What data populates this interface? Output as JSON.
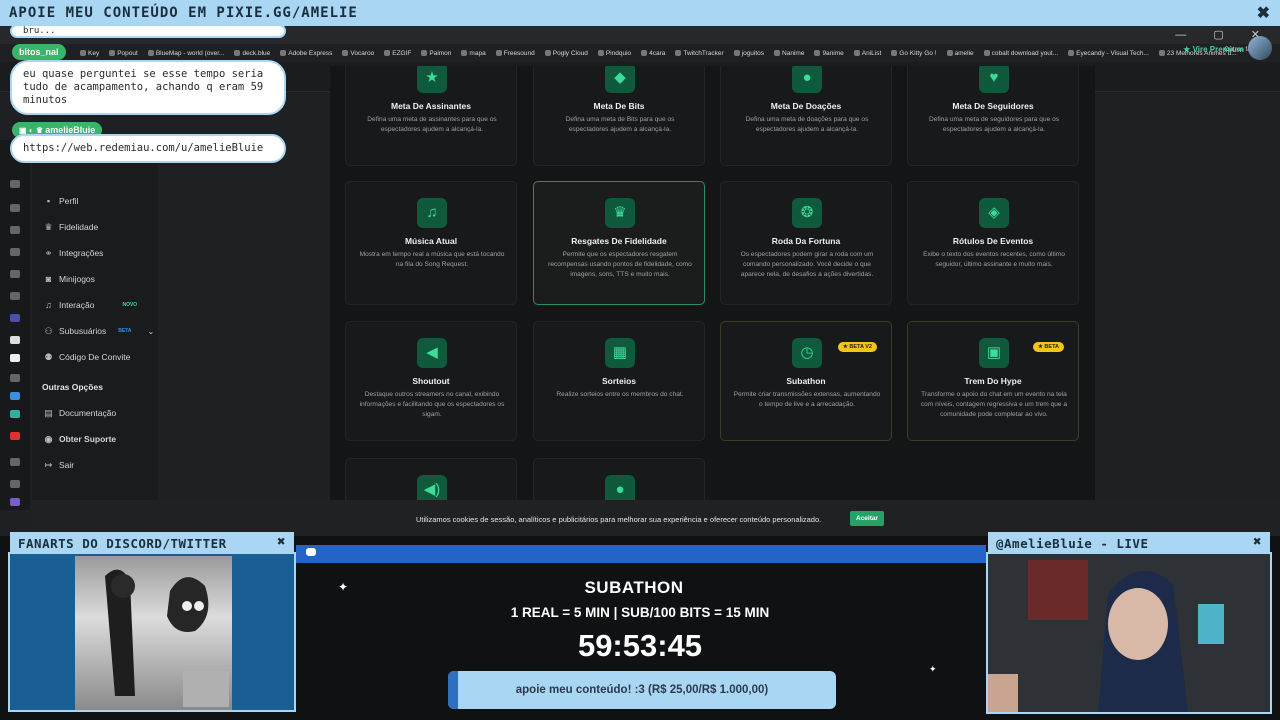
{
  "banner": {
    "text": "APOIE MEU CONTEÚDO EM PIXIE.GG/AMELIE",
    "close": "✖"
  },
  "browser": {
    "bookmarks": [
      "Key",
      "Popout",
      "BlueMap - world (over...",
      "deck.blue",
      "Adobe Express",
      "Vocaroo",
      "EZGIF",
      "Paimon",
      "mapa",
      "Freesound",
      "Pogly Cloud",
      "Pindquio",
      "4cara",
      "TwitchTracker",
      "joguitos",
      "Nanime",
      "9anime",
      "AniList",
      "Go Kitty Go !",
      "amelie",
      "cobalt download yout...",
      "Eyecandy - Visual Tech...",
      "23 Melhores Animes d..."
    ],
    "favorites": "Outros favoritos",
    "window_controls": "— ▢ ✕"
  },
  "header": {
    "premium": "Vire Premium"
  },
  "sidebar": {
    "items": [
      {
        "label": "Perfil",
        "icon": "user-icon",
        "glyph": "▪"
      },
      {
        "label": "Fidelidade",
        "icon": "trophy-icon",
        "glyph": "♛"
      },
      {
        "label": "Integrações",
        "icon": "link-icon",
        "glyph": "⚭"
      },
      {
        "label": "Minijogos",
        "icon": "gamepad-icon",
        "glyph": "◙"
      },
      {
        "label": "Interação",
        "icon": "music-icon",
        "glyph": "♫"
      },
      {
        "label": "Subusuários",
        "icon": "users-icon",
        "glyph": "⚇"
      },
      {
        "label": "Código De Convite",
        "icon": "invite-icon",
        "glyph": "⚉"
      }
    ],
    "interacao_badge": "NOVO",
    "subusuarios_badge": "BETA",
    "section": "Outras Opções",
    "footer_items": [
      {
        "label": "Documentação",
        "icon": "doc-icon",
        "glyph": "▤"
      },
      {
        "label": "Obter Suporte",
        "icon": "support-icon",
        "glyph": "◉"
      },
      {
        "label": "Sair",
        "icon": "logout-icon",
        "glyph": "↦"
      }
    ]
  },
  "cards": [
    {
      "title": "Meta De Assinantes",
      "desc": "Defina uma meta de assinantes para que os espectadores ajudem a alcançá-la.",
      "icon": "star-icon",
      "glyph": "★"
    },
    {
      "title": "Meta De Bits",
      "desc": "Defina uma meta de Bits para que os espectadores ajudem a alcançá-la.",
      "icon": "diamond-icon",
      "glyph": "◆"
    },
    {
      "title": "Meta De Doações",
      "desc": "Defina uma meta de doações para que os espectadores ajudem a alcançá-la.",
      "icon": "coin-icon",
      "glyph": "●"
    },
    {
      "title": "Meta De Seguidores",
      "desc": "Defina uma meta de seguidores para que os espectadores ajudem a alcançá-la.",
      "icon": "heart-icon",
      "glyph": "♥"
    },
    {
      "title": "Música Atual",
      "desc": "Mostra em tempo real a música que está tocando na fila do Song Request.",
      "icon": "music-icon",
      "glyph": "♫"
    },
    {
      "title": "Resgates De Fidelidade",
      "desc": "Permite que os espectadores resgatem recompensas usando pontos de fidelidade, como imagens, sons, TTS e muito mais.",
      "icon": "trophy-icon",
      "glyph": "♛"
    },
    {
      "title": "Roda Da Fortuna",
      "desc": "Os espectadores podem girar a roda com um comando personalizado. Você decide o que aparece nela, de desafios a ações divertidas.",
      "icon": "wheel-icon",
      "glyph": "❂"
    },
    {
      "title": "Rótulos De Eventos",
      "desc": "Exibe o texto dos eventos recentes, como último seguidor, último assinante e muito mais.",
      "icon": "tag-icon",
      "glyph": "◈"
    },
    {
      "title": "Shoutout",
      "desc": "Destaque outros streamers no canal, exibindo informações e facilitando que os espectadores os sigam.",
      "icon": "megaphone-icon",
      "glyph": "◀"
    },
    {
      "title": "Sorteios",
      "desc": "Realize sorteios entre os membros do chat.",
      "icon": "gift-icon",
      "glyph": "▦"
    },
    {
      "title": "Subathon",
      "desc": "Permite criar transmissões extensas, aumentando o tempo de live e a arrecadação.",
      "icon": "clock-icon",
      "glyph": "◷",
      "badge": "★ BETA V2"
    },
    {
      "title": "Trem Do Hype",
      "desc": "Transforme o apoio do chat em um evento na tela com níveis, contagem regressiva e um trem que a comunidade pode completar ao vivo.",
      "icon": "train-icon",
      "glyph": "▣",
      "badge": "★ BETA"
    },
    {
      "title": "",
      "desc": "",
      "icon": "speaker-icon",
      "glyph": "◀)"
    },
    {
      "title": "",
      "desc": "",
      "icon": "bulb-icon",
      "glyph": "●"
    }
  ],
  "cookie": {
    "text": "Utilizamos cookies de sessão, analíticos e publicitários para melhorar sua experiência e oferecer conteúdo personalizado.",
    "accept": "Aceitar"
  },
  "chat": [
    {
      "name": "bitos_nal",
      "message": "eu quase perguntei se esse tempo seria tudo de acampamento, achando q eram 59 minutos"
    },
    {
      "name": "amelieBluie",
      "message": "https://web.redemiau.com/u/amelieBluie"
    }
  ],
  "chat_top_fragment": "bru...",
  "fanart": {
    "title": "FANARTS DO DISCORD/TWITTER",
    "close": "✖"
  },
  "cam": {
    "title": "@AmelieBluie - LIVE",
    "close": "✖"
  },
  "subathon": {
    "title": "SUBATHON",
    "rate": "1 REAL = 5 MIN | SUB/100 BITS = 15 MIN",
    "timer": "59:53:45",
    "goal_text": "apoie meu conteúdo! :3 (R$ 25,00/R$ 1.000,00)",
    "goal_progress": 0.025
  },
  "colors": {
    "accent": "#3ddc9a",
    "banner": "#a9d6f2",
    "beta": "#f2c517"
  }
}
